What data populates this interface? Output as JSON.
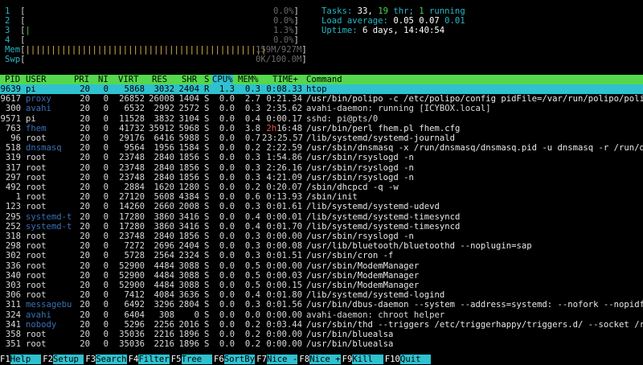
{
  "meters": {
    "cpus": [
      {
        "id": "1",
        "percent": "0.0%"
      },
      {
        "id": "2",
        "percent": "0.0%"
      },
      {
        "id": "3",
        "percent": "1.3%"
      },
      {
        "id": "4",
        "percent": "0.0%"
      }
    ],
    "mem": {
      "label": "Mem",
      "value": "159M/927M"
    },
    "swp": {
      "label": "Swp",
      "value": "0K/100.0M"
    }
  },
  "summary": {
    "tasks_label": "Tasks:",
    "tasks": "33,",
    "threads": "19",
    "thr_label": "thr;",
    "running": "1",
    "running_label": "running",
    "load_label": "Load average:",
    "load1": "0.05",
    "load5": "0.07",
    "load15": "0.01",
    "uptime_label": "Uptime:",
    "uptime": "6 days, 14:40:54"
  },
  "columns": {
    "pid": "PID",
    "user": "USER",
    "pri": "PRI",
    "ni": "NI",
    "virt": "VIRT",
    "res": "RES",
    "shr": "SHR",
    "s": "S",
    "cpu": "CPU%",
    "mem": "MEM%",
    "time": "TIME+",
    "command": "Command"
  },
  "processes": [
    {
      "pid": "9639",
      "user": "pi",
      "pri": "20",
      "ni": "0",
      "virt": "5868",
      "res": "3032",
      "shr": "2404",
      "s": "R",
      "cpu": "1.3",
      "mem": "0.3",
      "time": "0:08.33",
      "command": "htop"
    },
    {
      "pid": "9617",
      "user": "proxy",
      "pri": "20",
      "ni": "0",
      "virt": "26852",
      "res": "26008",
      "shr": "1404",
      "s": "S",
      "cpu": "0.0",
      "mem": "2.7",
      "time": "0:21.34",
      "command": "/usr/bin/polipo -c /etc/polipo/config pidFile=/var/run/polipo/polipo"
    },
    {
      "pid": "300",
      "user": "avahi",
      "pri": "20",
      "ni": "0",
      "virt": "6532",
      "res": "2992",
      "shr": "2572",
      "s": "S",
      "cpu": "0.0",
      "mem": "0.3",
      "time": "2:35.62",
      "command": "avahi-daemon: running [ICYBOX.local]"
    },
    {
      "pid": "9571",
      "user": "pi",
      "pri": "20",
      "ni": "0",
      "virt": "11528",
      "res": "3832",
      "shr": "3104",
      "s": "S",
      "cpu": "0.0",
      "mem": "0.4",
      "time": "0:00.17",
      "command": "sshd: pi@pts/0"
    },
    {
      "pid": "763",
      "user": "fhem",
      "pri": "20",
      "ni": "0",
      "virt": "41732",
      "res": "35912",
      "shr": "5968",
      "s": "S",
      "cpu": "0.0",
      "mem": "3.8",
      "time": "2h16:48",
      "command": "/usr/bin/perl fhem.pl fhem.cfg"
    },
    {
      "pid": "96",
      "user": "root",
      "pri": "20",
      "ni": "0",
      "virt": "29176",
      "res": "6416",
      "shr": "5988",
      "s": "S",
      "cpu": "0.0",
      "mem": "0.7",
      "time": "23:25.57",
      "command": "/lib/systemd/systemd-journald"
    },
    {
      "pid": "518",
      "user": "dnsmasq",
      "pri": "20",
      "ni": "0",
      "virt": "9564",
      "res": "1956",
      "shr": "1584",
      "s": "S",
      "cpu": "0.0",
      "mem": "0.2",
      "time": "2:22.59",
      "command": "/usr/sbin/dnsmasq -x /run/dnsmasq/dnsmasq.pid -u dnsmasq -r /run/dnsm"
    },
    {
      "pid": "319",
      "user": "root",
      "pri": "20",
      "ni": "0",
      "virt": "23748",
      "res": "2840",
      "shr": "1856",
      "s": "S",
      "cpu": "0.0",
      "mem": "0.3",
      "time": "1:54.86",
      "command": "/usr/sbin/rsyslogd -n"
    },
    {
      "pid": "317",
      "user": "root",
      "pri": "20",
      "ni": "0",
      "virt": "23748",
      "res": "2840",
      "shr": "1856",
      "s": "S",
      "cpu": "0.0",
      "mem": "0.3",
      "time": "2:26.16",
      "command": "/usr/sbin/rsyslogd -n"
    },
    {
      "pid": "297",
      "user": "root",
      "pri": "20",
      "ni": "0",
      "virt": "23748",
      "res": "2840",
      "shr": "1856",
      "s": "S",
      "cpu": "0.0",
      "mem": "0.3",
      "time": "4:21.09",
      "command": "/usr/sbin/rsyslogd -n"
    },
    {
      "pid": "492",
      "user": "root",
      "pri": "20",
      "ni": "0",
      "virt": "2884",
      "res": "1620",
      "shr": "1280",
      "s": "S",
      "cpu": "0.0",
      "mem": "0.2",
      "time": "0:20.07",
      "command": "/sbin/dhcpcd -q -w"
    },
    {
      "pid": "1",
      "user": "root",
      "pri": "20",
      "ni": "0",
      "virt": "27120",
      "res": "5608",
      "shr": "4384",
      "s": "S",
      "cpu": "0.0",
      "mem": "0.6",
      "time": "0:13.93",
      "command": "/sbin/init"
    },
    {
      "pid": "123",
      "user": "root",
      "pri": "20",
      "ni": "0",
      "virt": "14260",
      "res": "2660",
      "shr": "2008",
      "s": "S",
      "cpu": "0.0",
      "mem": "0.3",
      "time": "0:01.61",
      "command": "/lib/systemd/systemd-udevd"
    },
    {
      "pid": "295",
      "user": "systemd-t",
      "pri": "20",
      "ni": "0",
      "virt": "17280",
      "res": "3860",
      "shr": "3416",
      "s": "S",
      "cpu": "0.0",
      "mem": "0.4",
      "time": "0:00.01",
      "command": "/lib/systemd/systemd-timesyncd"
    },
    {
      "pid": "252",
      "user": "systemd-t",
      "pri": "20",
      "ni": "0",
      "virt": "17280",
      "res": "3860",
      "shr": "3416",
      "s": "S",
      "cpu": "0.0",
      "mem": "0.4",
      "time": "0:01.70",
      "command": "/lib/systemd/systemd-timesyncd"
    },
    {
      "pid": "318",
      "user": "root",
      "pri": "20",
      "ni": "0",
      "virt": "23748",
      "res": "2840",
      "shr": "1856",
      "s": "S",
      "cpu": "0.0",
      "mem": "0.3",
      "time": "0:00.00",
      "command": "/usr/sbin/rsyslogd -n"
    },
    {
      "pid": "298",
      "user": "root",
      "pri": "20",
      "ni": "0",
      "virt": "7272",
      "res": "2696",
      "shr": "2404",
      "s": "S",
      "cpu": "0.0",
      "mem": "0.3",
      "time": "0:00.08",
      "command": "/usr/lib/bluetooth/bluetoothd --noplugin=sap"
    },
    {
      "pid": "302",
      "user": "root",
      "pri": "20",
      "ni": "0",
      "virt": "5728",
      "res": "2564",
      "shr": "2324",
      "s": "S",
      "cpu": "0.0",
      "mem": "0.3",
      "time": "0:01.51",
      "command": "/usr/sbin/cron -f"
    },
    {
      "pid": "336",
      "user": "root",
      "pri": "20",
      "ni": "0",
      "virt": "52900",
      "res": "4484",
      "shr": "3088",
      "s": "S",
      "cpu": "0.0",
      "mem": "0.5",
      "time": "0:00.00",
      "command": "/usr/sbin/ModemManager"
    },
    {
      "pid": "340",
      "user": "root",
      "pri": "20",
      "ni": "0",
      "virt": "52900",
      "res": "4484",
      "shr": "3088",
      "s": "S",
      "cpu": "0.0",
      "mem": "0.5",
      "time": "0:00.03",
      "command": "/usr/sbin/ModemManager"
    },
    {
      "pid": "303",
      "user": "root",
      "pri": "20",
      "ni": "0",
      "virt": "52900",
      "res": "4484",
      "shr": "3088",
      "s": "S",
      "cpu": "0.0",
      "mem": "0.5",
      "time": "0:00.15",
      "command": "/usr/sbin/ModemManager"
    },
    {
      "pid": "306",
      "user": "root",
      "pri": "20",
      "ni": "0",
      "virt": "7412",
      "res": "4084",
      "shr": "3636",
      "s": "S",
      "cpu": "0.0",
      "mem": "0.4",
      "time": "0:01.80",
      "command": "/lib/systemd/systemd-logind"
    },
    {
      "pid": "311",
      "user": "messagebu",
      "pri": "20",
      "ni": "0",
      "virt": "6492",
      "res": "3296",
      "shr": "2804",
      "s": "S",
      "cpu": "0.0",
      "mem": "0.3",
      "time": "0:01.56",
      "command": "/usr/bin/dbus-daemon --system --address=systemd: --nofork --nopidfile"
    },
    {
      "pid": "324",
      "user": "avahi",
      "pri": "20",
      "ni": "0",
      "virt": "6404",
      "res": "308",
      "shr": "0",
      "s": "S",
      "cpu": "0.0",
      "mem": "0.0",
      "time": "0:00.00",
      "command": "avahi-daemon: chroot helper"
    },
    {
      "pid": "341",
      "user": "nobody",
      "pri": "20",
      "ni": "0",
      "virt": "5296",
      "res": "2256",
      "shr": "2016",
      "s": "S",
      "cpu": "0.0",
      "mem": "0.2",
      "time": "0:03.44",
      "command": "/usr/sbin/thd --triggers /etc/triggerhappy/triggers.d/ --socket /run/"
    },
    {
      "pid": "358",
      "user": "root",
      "pri": "20",
      "ni": "0",
      "virt": "35036",
      "res": "2216",
      "shr": "1896",
      "s": "S",
      "cpu": "0.0",
      "mem": "0.2",
      "time": "0:00.00",
      "command": "/usr/bin/bluealsa"
    },
    {
      "pid": "351",
      "user": "root",
      "pri": "20",
      "ni": "0",
      "virt": "35036",
      "res": "2216",
      "shr": "1896",
      "s": "S",
      "cpu": "0.0",
      "mem": "0.2",
      "time": "0:00.00",
      "command": "/usr/bin/bluealsa"
    }
  ],
  "fkeys": [
    {
      "key": "F1",
      "label": "Help  "
    },
    {
      "key": "F2",
      "label": "Setup "
    },
    {
      "key": "F3",
      "label": "Search"
    },
    {
      "key": "F4",
      "label": "Filter"
    },
    {
      "key": "F5",
      "label": "Tree  "
    },
    {
      "key": "F6",
      "label": "SortBy"
    },
    {
      "key": "F7",
      "label": "Nice -"
    },
    {
      "key": "F8",
      "label": "Nice +"
    },
    {
      "key": "F9",
      "label": "Kill  "
    },
    {
      "key": "F10",
      "label": "Quit  "
    }
  ]
}
